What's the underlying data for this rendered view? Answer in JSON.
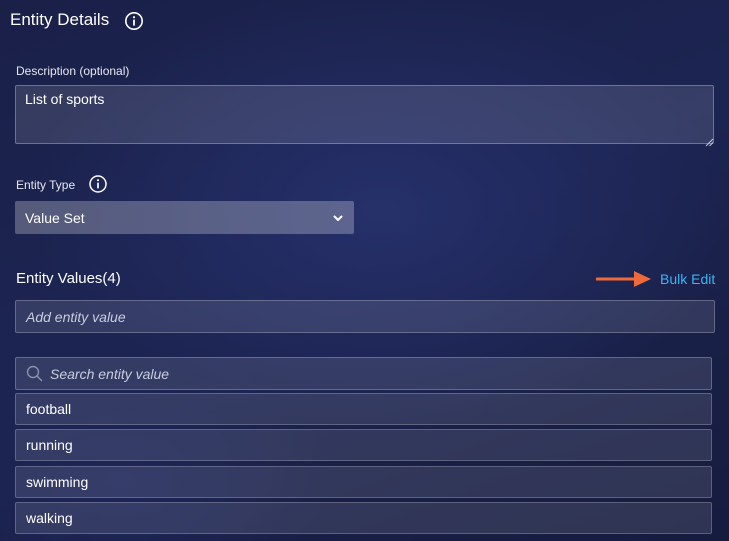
{
  "header": {
    "title": "Entity Details",
    "info_icon": "info-icon"
  },
  "description": {
    "label": "Description (optional)",
    "value": "List of sports"
  },
  "entity_type": {
    "label": "Entity Type",
    "info_icon": "info-icon",
    "selected": "Value Set",
    "dropdown_icon": "chevron-down-icon"
  },
  "entity_values": {
    "header": "Entity Values(4)",
    "bulk_edit_label": "Bulk Edit",
    "annotation_icon": "arrow-right-icon",
    "add_placeholder": "Add entity value",
    "search_placeholder": "Search entity value",
    "search_icon": "search-icon",
    "items": [
      "football",
      "running",
      "swimming",
      "walking"
    ]
  },
  "colors": {
    "background": "#1c2452",
    "link": "#3fb3f3",
    "annotation_arrow": "#ee6a3b",
    "text": "#ffffff"
  }
}
